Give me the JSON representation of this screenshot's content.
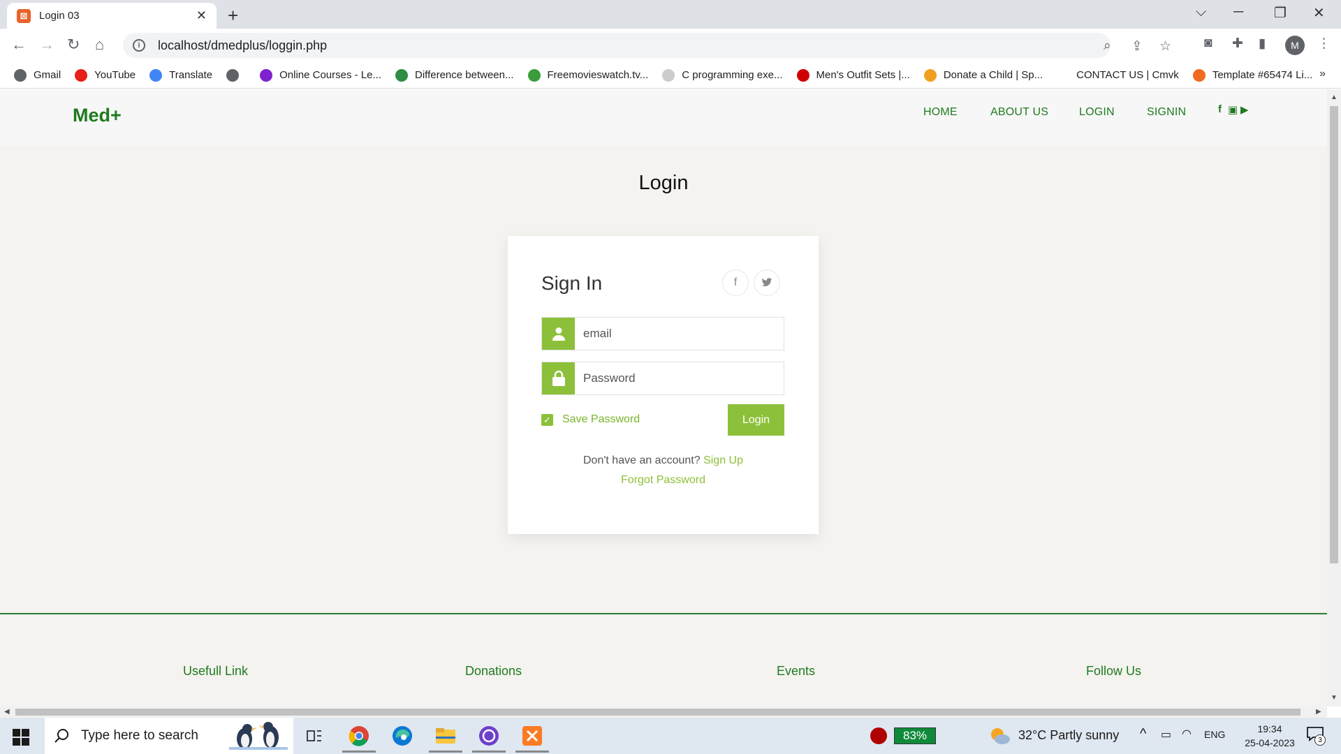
{
  "browser": {
    "tab_title": "Login 03",
    "url": "localhost/dmedplus/loggin.php",
    "profile_initial": "M",
    "bookmarks": [
      {
        "label": "Gmail",
        "color": "#5f6368"
      },
      {
        "label": "YouTube",
        "color": "#e62117"
      },
      {
        "label": "Translate",
        "color": "#4285f4"
      },
      {
        "label": "",
        "color": "#5f6368"
      },
      {
        "label": "Online Courses - Le...",
        "color": "#7e22ce"
      },
      {
        "label": "Difference between...",
        "color": "#2f8d46"
      },
      {
        "label": "Freemovieswatch.tv...",
        "color": "#3a9d3a"
      },
      {
        "label": "C programming exe...",
        "color": "#cccccc"
      },
      {
        "label": "Men's Outfit Sets |...",
        "color": "#d00000"
      },
      {
        "label": "Donate a Child | Sp...",
        "color": "#f0a020"
      },
      {
        "label": "CONTACT US | Cmvk",
        "color": "#ffffff"
      },
      {
        "label": "Template #65474 Li...",
        "color": "#f06a20"
      }
    ]
  },
  "site": {
    "brand": "Med+",
    "nav": {
      "home": "HOME",
      "about": "ABOUT US",
      "login": "LOGIN",
      "signin": "SIGNIN"
    },
    "page_title": "Login",
    "accent_color": "#8dc03a",
    "brand_color": "#1f7a1f"
  },
  "card": {
    "title": "Sign In",
    "email_placeholder": "email",
    "password_placeholder": "Password",
    "save_password": "Save Password",
    "login_button": "Login",
    "no_account": "Don't have an account?",
    "sign_up": "Sign Up",
    "forgot": "Forgot Password"
  },
  "footer": {
    "useful": "Usefull Link",
    "donations": "Donations",
    "events": "Events",
    "follow": "Follow Us"
  },
  "taskbar": {
    "search_placeholder": "Type here to search",
    "battery_badge": "83%",
    "weather": "32°C  Partly sunny",
    "language": "ENG",
    "time": "19:34",
    "date": "25-04-2023",
    "notifications": "3"
  }
}
